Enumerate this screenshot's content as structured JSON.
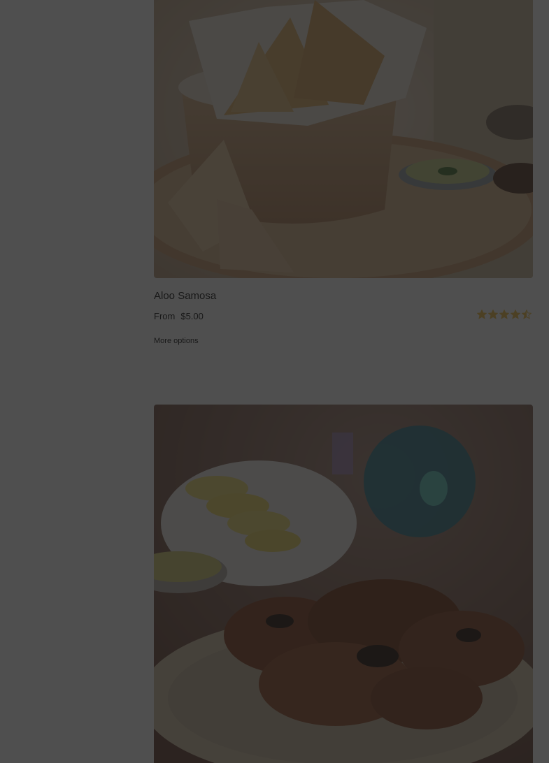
{
  "products": [
    {
      "title": "Aloo Samosa",
      "price_prefix": "From",
      "price": "$5.00",
      "rating": 4.5,
      "rating_max": 5,
      "more_options_label": "More options",
      "image": "samosa-photo"
    },
    {
      "image": "tandoori-chicken-photo"
    }
  ],
  "colors": {
    "star": "#f0c24b",
    "overlay": "rgba(24,24,24,0.76)"
  }
}
